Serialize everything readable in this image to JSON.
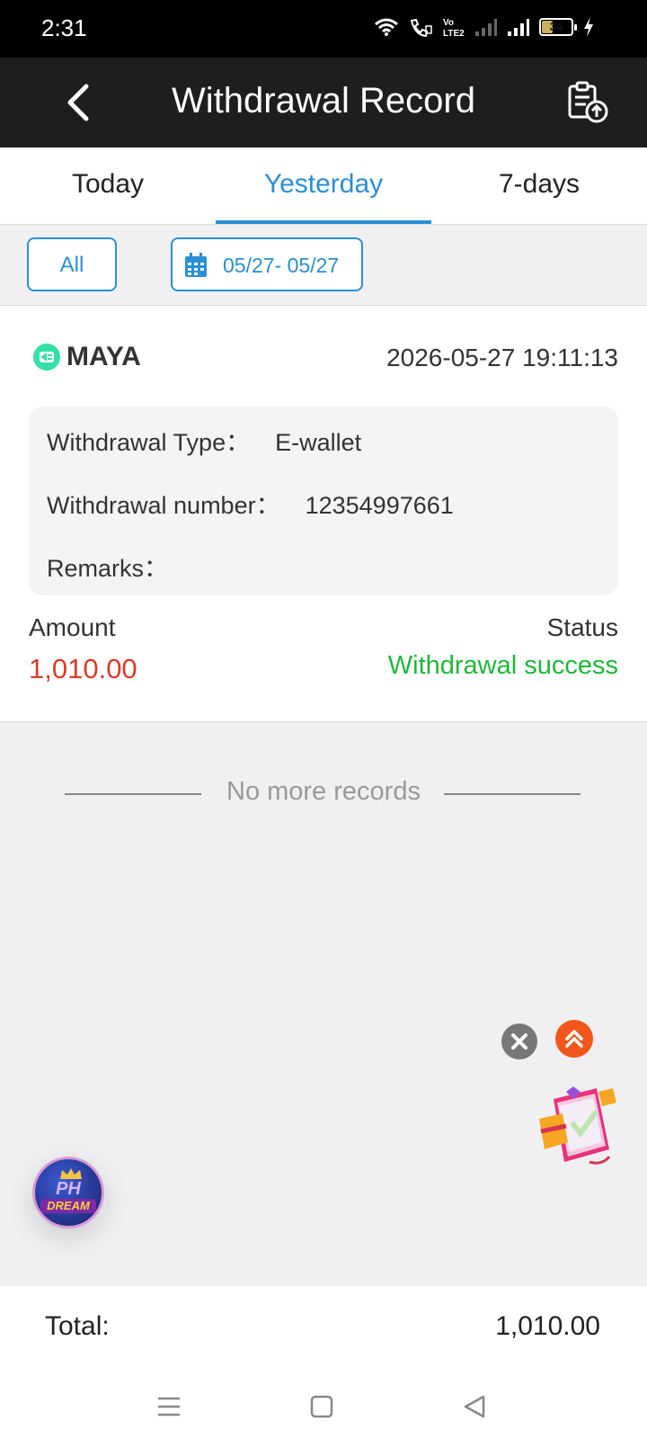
{
  "status_bar": {
    "time": "2:31",
    "battery": "34"
  },
  "header": {
    "title": "Withdrawal Record"
  },
  "tabs": [
    {
      "label": "Today",
      "active": false
    },
    {
      "label": "Yesterday",
      "active": true
    },
    {
      "label": "7-days",
      "active": false
    }
  ],
  "filter": {
    "type_label": "All",
    "date_range": "05/27- 05/27"
  },
  "record": {
    "wallet_name": "MAYA",
    "datetime": "2026-05-27 19:11:13",
    "type_label": "Withdrawal Type：",
    "type_value": "E-wallet",
    "number_label": "Withdrawal number：",
    "number_value": "12354997661",
    "remarks_label": "Remarks：",
    "remarks_value": "",
    "amount_label": "Amount",
    "amount_value": "1,010.00",
    "status_label": "Status",
    "status_value": "Withdrawal success"
  },
  "no_more_text": "No more records",
  "floating_logo": {
    "top_text": "PH",
    "bottom_text": "DREAM"
  },
  "total": {
    "label": "Total:",
    "value": "1,010.00"
  },
  "colors": {
    "accent": "#2a8fd6",
    "amount": "#d63d2c",
    "success": "#1fb83a",
    "header_bg": "#1e1e1e",
    "maya_brand": "#33e0a6"
  },
  "icons": [
    "back-arrow-icon",
    "record-upload-icon",
    "calendar-icon",
    "maya-logo-icon",
    "close-icon",
    "scroll-top-icon",
    "gift-icon",
    "menu-icon",
    "home-icon",
    "back-nav-icon"
  ]
}
